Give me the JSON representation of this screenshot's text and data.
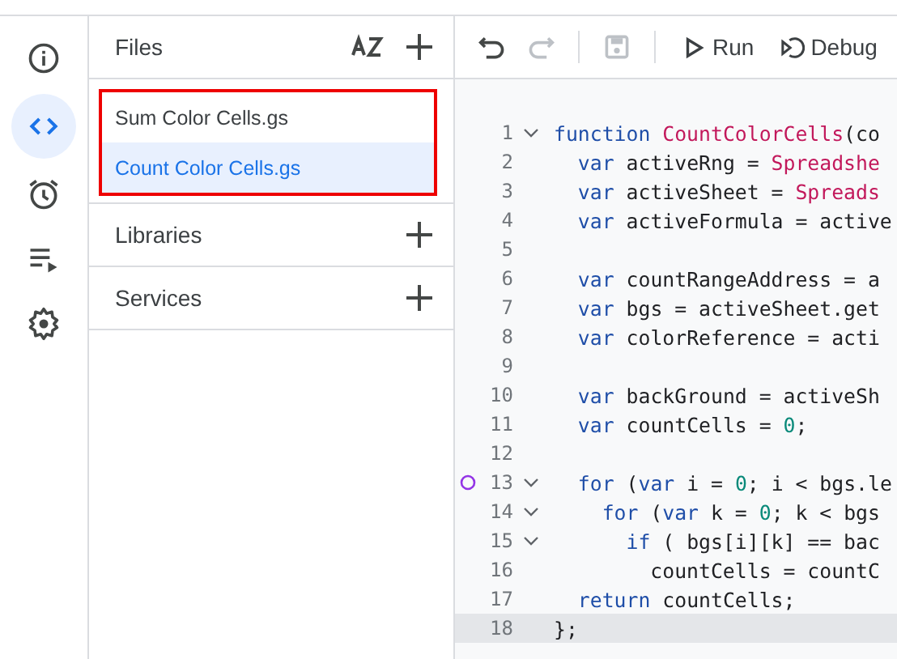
{
  "rail": [
    {
      "kind": "info",
      "selected": false
    },
    {
      "kind": "code",
      "selected": true
    },
    {
      "kind": "alarm",
      "selected": false
    },
    {
      "kind": "executions",
      "selected": false
    },
    {
      "kind": "settings",
      "selected": false
    }
  ],
  "files": {
    "title": "Files",
    "items": [
      {
        "name": "Sum Color Cells.gs",
        "selected": false
      },
      {
        "name": "Count Color Cells.gs",
        "selected": true
      }
    ],
    "highlighted": true
  },
  "sections": [
    {
      "title": "Libraries"
    },
    {
      "title": "Services"
    }
  ],
  "toolbar": {
    "undo_disabled": false,
    "redo_disabled": true,
    "save_disabled": true,
    "run": "Run",
    "debug": "Debug"
  },
  "code": [
    {
      "number": "1",
      "fold": true,
      "breakpoint": false,
      "current": false,
      "tokens": [
        {
          "kind": "kw",
          "text": "function "
        },
        {
          "kind": "fn",
          "text": "CountColorCells"
        },
        {
          "kind": "plain",
          "text": "(co"
        }
      ]
    },
    {
      "number": "2",
      "fold": false,
      "breakpoint": false,
      "current": false,
      "tokens": [
        {
          "kind": "kw",
          "text": "  var"
        },
        {
          "kind": "plain",
          "text": " activeRng = "
        },
        {
          "kind": "fn",
          "text": "Spreadshe"
        }
      ]
    },
    {
      "number": "3",
      "fold": false,
      "breakpoint": false,
      "current": false,
      "tokens": [
        {
          "kind": "kw",
          "text": "  var"
        },
        {
          "kind": "plain",
          "text": " activeSheet = "
        },
        {
          "kind": "fn",
          "text": "Spreads"
        }
      ]
    },
    {
      "number": "4",
      "fold": false,
      "breakpoint": false,
      "current": false,
      "tokens": [
        {
          "kind": "kw",
          "text": "  var"
        },
        {
          "kind": "plain",
          "text": " activeFormula = active"
        }
      ]
    },
    {
      "number": "5",
      "fold": false,
      "breakpoint": false,
      "current": false
    },
    {
      "number": "6",
      "fold": false,
      "breakpoint": false,
      "current": false,
      "tokens": [
        {
          "kind": "kw",
          "text": "  var"
        },
        {
          "kind": "plain",
          "text": " countRangeAddress = a"
        }
      ]
    },
    {
      "number": "7",
      "fold": false,
      "breakpoint": false,
      "current": false,
      "tokens": [
        {
          "kind": "kw",
          "text": "  var"
        },
        {
          "kind": "plain",
          "text": " bgs = activeSheet.get"
        }
      ]
    },
    {
      "number": "8",
      "fold": false,
      "breakpoint": false,
      "current": false,
      "tokens": [
        {
          "kind": "kw",
          "text": "  var"
        },
        {
          "kind": "plain",
          "text": " colorReference = acti"
        }
      ]
    },
    {
      "number": "9",
      "fold": false,
      "breakpoint": false,
      "current": false
    },
    {
      "number": "10",
      "fold": false,
      "breakpoint": false,
      "current": false,
      "tokens": [
        {
          "kind": "kw",
          "text": "  var"
        },
        {
          "kind": "plain",
          "text": " backGround = activeSh"
        }
      ]
    },
    {
      "number": "11",
      "fold": false,
      "breakpoint": false,
      "current": false,
      "tokens": [
        {
          "kind": "kw",
          "text": "  var"
        },
        {
          "kind": "plain",
          "text": " countCells = "
        },
        {
          "kind": "num",
          "text": "0"
        },
        {
          "kind": "plain",
          "text": ";"
        }
      ]
    },
    {
      "number": "12",
      "fold": false,
      "breakpoint": false,
      "current": false
    },
    {
      "number": "13",
      "fold": true,
      "breakpoint": true,
      "current": false,
      "tokens": [
        {
          "kind": "kw",
          "text": "  for"
        },
        {
          "kind": "plain",
          "text": " ("
        },
        {
          "kind": "kw",
          "text": "var"
        },
        {
          "kind": "plain",
          "text": " i = "
        },
        {
          "kind": "num",
          "text": "0"
        },
        {
          "kind": "plain",
          "text": "; i < bgs.le"
        }
      ]
    },
    {
      "number": "14",
      "fold": true,
      "breakpoint": false,
      "current": false,
      "tokens": [
        {
          "kind": "kw",
          "text": "    for"
        },
        {
          "kind": "plain",
          "text": " ("
        },
        {
          "kind": "kw",
          "text": "var"
        },
        {
          "kind": "plain",
          "text": " k = "
        },
        {
          "kind": "num",
          "text": "0"
        },
        {
          "kind": "plain",
          "text": "; k < bgs"
        }
      ]
    },
    {
      "number": "15",
      "fold": true,
      "breakpoint": false,
      "current": false,
      "tokens": [
        {
          "kind": "kw",
          "text": "      if"
        },
        {
          "kind": "plain",
          "text": " ( bgs[i][k] == bac"
        }
      ]
    },
    {
      "number": "16",
      "fold": false,
      "breakpoint": false,
      "current": false,
      "tokens": [
        {
          "kind": "plain",
          "text": "        countCells = countC"
        }
      ]
    },
    {
      "number": "17",
      "fold": false,
      "breakpoint": false,
      "current": false,
      "tokens": [
        {
          "kind": "kw",
          "text": "  return"
        },
        {
          "kind": "plain",
          "text": " countCells;"
        }
      ]
    },
    {
      "number": "18",
      "fold": false,
      "breakpoint": false,
      "current": true,
      "tokens": [
        {
          "kind": "plain",
          "text": "};"
        }
      ]
    }
  ]
}
